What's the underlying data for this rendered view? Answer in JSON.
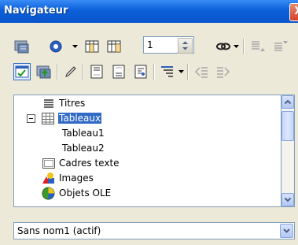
{
  "window": {
    "title": "Navigateur",
    "close_glyph": "X"
  },
  "toolbar": {
    "page_number": "1",
    "row1_icons": [
      "toggle-icon",
      "navigation-icon",
      "previous-icon",
      "next-icon",
      "reminder-icon",
      "promote-chapter-icon",
      "demote-chapter-icon"
    ],
    "row2_icons": [
      "content-view-icon",
      "promote-level-icon",
      "edit-icon",
      "header-icon",
      "footer-icon",
      "anchor-icon",
      "heading-levels-icon",
      "outline-promote-icon",
      "outline-demote-icon"
    ]
  },
  "tree": {
    "items": [
      {
        "label": "Titres",
        "icon": "headings-icon",
        "level": 0
      },
      {
        "label": "Tableaux",
        "icon": "table-icon",
        "level": 0,
        "expanded": true,
        "selected": true
      },
      {
        "label": "Tableau1",
        "icon": "",
        "level": 1
      },
      {
        "label": "Tableau2",
        "icon": "",
        "level": 1
      },
      {
        "label": "Cadres texte",
        "icon": "text-frame-icon",
        "level": 0
      },
      {
        "label": "Images",
        "icon": "images-icon",
        "level": 0
      },
      {
        "label": "Objets OLE",
        "icon": "ole-objects-icon",
        "level": 0
      }
    ]
  },
  "document_select": {
    "value": "Sans nom1 (actif)"
  },
  "colors": {
    "titlebar": "#0a55cc",
    "selection": "#316ac5"
  }
}
